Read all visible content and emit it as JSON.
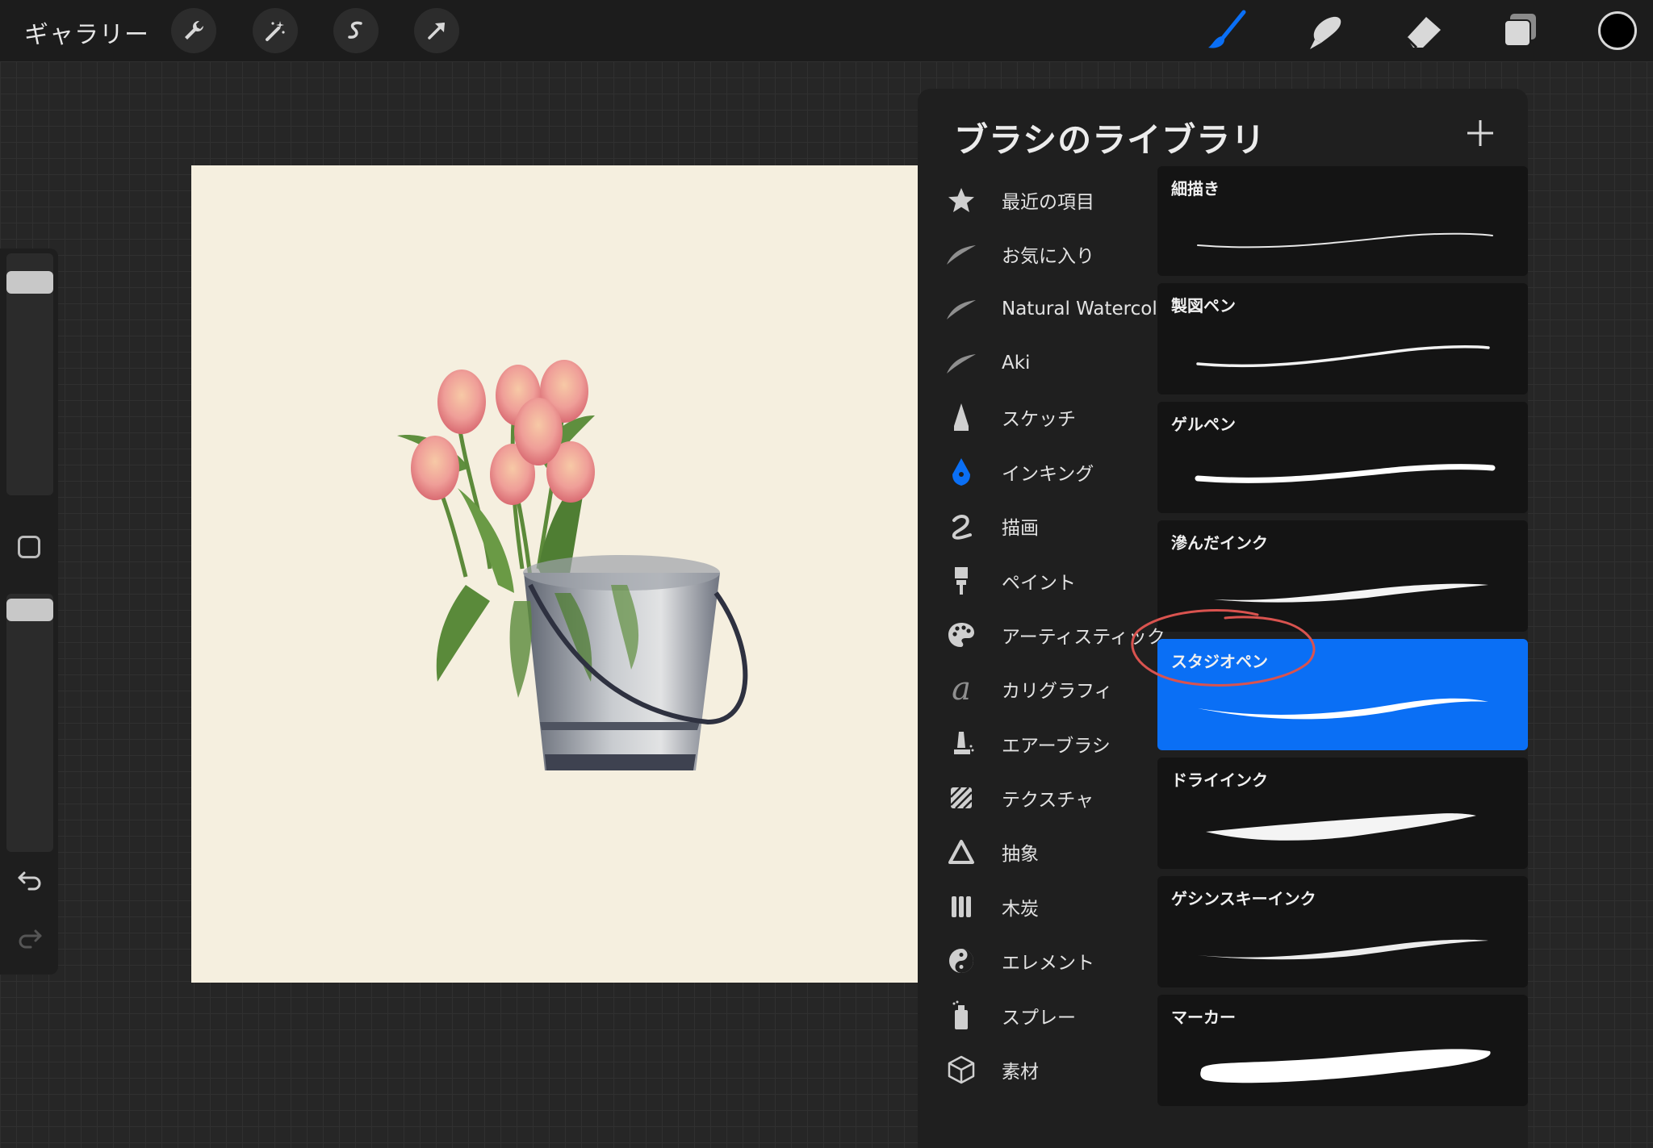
{
  "topbar": {
    "gallery_label": "ギャラリー",
    "left_tools": [
      "wrench-icon",
      "magic-wand-icon",
      "selection-icon",
      "transform-arrow-icon"
    ],
    "right_tools": [
      "brush-icon",
      "smudge-icon",
      "eraser-icon",
      "layers-icon"
    ],
    "active_tool": "brush",
    "active_color": "#0a6ff5",
    "current_color": "#000000"
  },
  "sidebar": {
    "brush_size_level": 0.92,
    "opacity_level": 0.98,
    "icons": [
      "modify-square-icon",
      "undo-icon",
      "redo-icon"
    ]
  },
  "panel": {
    "title": "ブラシのライブラリ",
    "add_label": "+",
    "sets": [
      {
        "label": "最近の項目",
        "icon": "star-icon"
      },
      {
        "label": "お気に入り",
        "icon": "stroke-icon"
      },
      {
        "label": "Natural Watercolor",
        "icon": "stroke-icon"
      },
      {
        "label": "Aki",
        "icon": "stroke-icon"
      },
      {
        "label": "スケッチ",
        "icon": "pencil-tip-icon"
      },
      {
        "label": "インキング",
        "icon": "pen-nib-icon",
        "active": true
      },
      {
        "label": "描画",
        "icon": "squiggle-icon"
      },
      {
        "label": "ペイント",
        "icon": "paint-brush-icon"
      },
      {
        "label": "アーティスティック",
        "icon": "palette-icon"
      },
      {
        "label": "カリグラフィ",
        "icon": "calligraphy-a-icon"
      },
      {
        "label": "エアーブラシ",
        "icon": "airbrush-icon"
      },
      {
        "label": "テクスチャ",
        "icon": "texture-icon"
      },
      {
        "label": "抽象",
        "icon": "triangle-icon"
      },
      {
        "label": "木炭",
        "icon": "charcoal-icon"
      },
      {
        "label": "エレメント",
        "icon": "yin-yang-icon"
      },
      {
        "label": "スプレー",
        "icon": "spray-can-icon"
      },
      {
        "label": "素材",
        "icon": "cube-icon"
      }
    ],
    "brushes": [
      {
        "name": "細描き"
      },
      {
        "name": "製図ペン"
      },
      {
        "name": "ゲルペン"
      },
      {
        "name": "滲んだインク"
      },
      {
        "name": "スタジオペン",
        "selected": true
      },
      {
        "name": "ドライインク"
      },
      {
        "name": "ゲシンスキーインク"
      },
      {
        "name": "マーカー"
      }
    ],
    "annotation_color": "#d9534f"
  }
}
